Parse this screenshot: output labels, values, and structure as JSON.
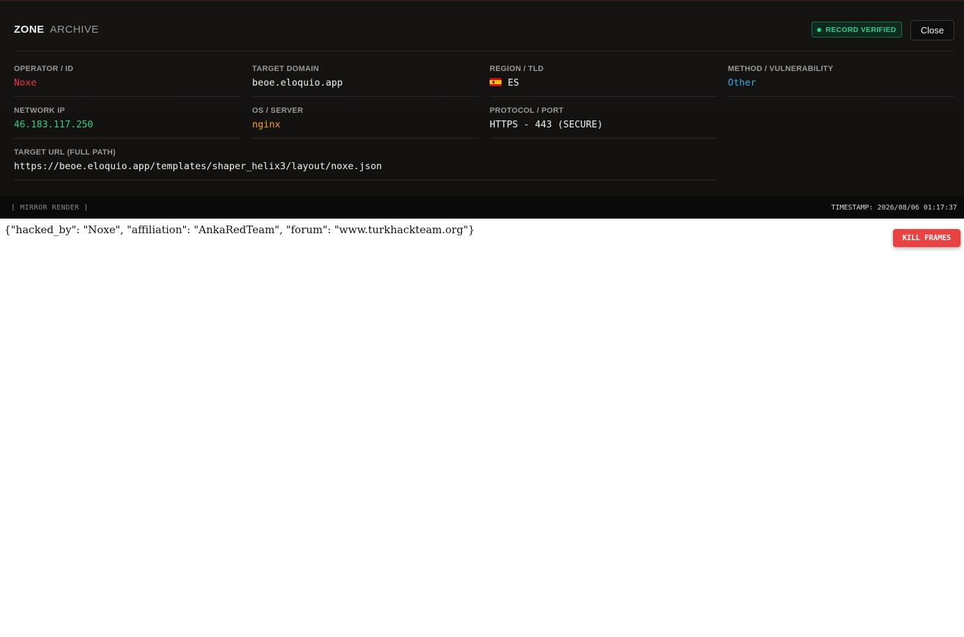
{
  "header": {
    "brand_primary": "ZONE",
    "brand_secondary": "ARCHIVE",
    "badge": "RECORD VERIFIED",
    "close_label": "Close"
  },
  "fields": {
    "operator": {
      "label": "OPERATOR / ID",
      "value": "Noxe"
    },
    "domain": {
      "label": "TARGET DOMAIN",
      "value": "beoe.eloquio.app"
    },
    "region": {
      "label": "REGION / TLD",
      "value": "ES",
      "flag": "spain-flag-icon"
    },
    "method": {
      "label": "METHOD / VULNERABILITY",
      "value": "Other"
    },
    "ip": {
      "label": "NETWORK IP",
      "value": "46.183.117.250"
    },
    "os": {
      "label": "OS / SERVER",
      "value": "nginx"
    },
    "protocol": {
      "label": "PROTOCOL / PORT",
      "value": "HTTPS - 443 (SECURE)"
    },
    "url": {
      "label": "TARGET URL (FULL PATH)",
      "value": "https://beoe.eloquio.app/templates/shaper_helix3/layout/noxe.json"
    }
  },
  "status": {
    "mirror": "[ MIRROR RENDER ]",
    "timestamp": "TIMESTAMP: 2026/08/06 01:17:37"
  },
  "mirror_content": "{\"hacked_by\": \"Noxe\", \"affiliation\": \"AnkaRedTeam\", \"forum\": \"www.turkhackteam.org\"}",
  "kill_label": "KILL FRAMES",
  "colors": {
    "operator": "#e8364a",
    "ip": "#2fcf86",
    "os": "#f59e1b",
    "method": "#3aa8e8",
    "badge": "#34c98a",
    "kill": "#e84242"
  }
}
